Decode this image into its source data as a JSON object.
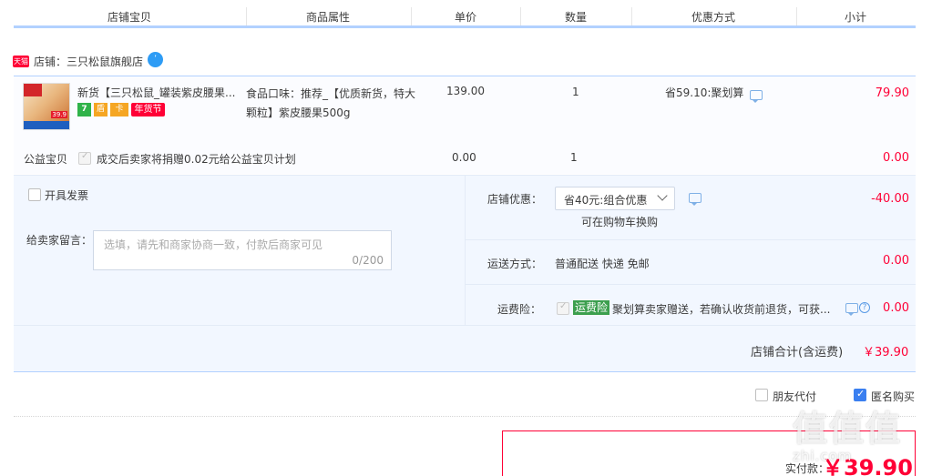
{
  "header": {
    "columns": [
      "店铺宝贝",
      "商品属性",
      "单价",
      "数量",
      "优惠方式",
      "小计"
    ]
  },
  "store": {
    "badge": "天猫",
    "name": "店铺：三只松鼠旗舰店",
    "chat_icon_glyph": "ʼ"
  },
  "item": {
    "thumb_tag": "39.9",
    "title": "新货【三只松鼠_罐装紫皮腰果...",
    "services": [
      "7",
      "盾",
      "卡",
      "年货节"
    ],
    "attr": "食品口味：推荐_【优质新货，特大颗粒】紫皮腰果500g",
    "price": "139.00",
    "qty": "1",
    "promo": "省59.10:聚划算",
    "subtotal": "79.90"
  },
  "charity": {
    "label": "公益宝贝",
    "text": "成交后卖家将捐赠0.02元给公益宝贝计划",
    "price": "0.00",
    "qty": "1",
    "subtotal": "0.00"
  },
  "options": {
    "invoice_label": "开具发票",
    "message_label": "给卖家留言：",
    "message_placeholder": "选填，请先和商家协商一致，付款后商家可见",
    "message_counter": "0/200",
    "store_discount_label": "店铺优惠：",
    "store_discount_value": "省40元:组合优惠",
    "store_discount_note": "可在购物车换购",
    "store_discount_amount": "-40.00",
    "shipping_label": "运送方式：",
    "shipping_value": "普通配送 快递 免邮",
    "shipping_amount": "0.00",
    "insurance_label": "运费险：",
    "insurance_tag": "运费险",
    "insurance_text": "聚划算卖家赠送，若确认收货前退货，可获...",
    "insurance_amount": "0.00",
    "store_total_label": "店铺合计(含运费)",
    "store_total_value": "￥39.90"
  },
  "footer": {
    "friend_pay": "朋友代付",
    "anonymous": "匿名购买",
    "pay_label": "实付款：",
    "pay_value": "￥39.90",
    "watermark": "值值值",
    "watermark_sub": "zhi.com"
  },
  "colors": {
    "accent_red": "#ff0036",
    "header_line": "#b2d1ff",
    "panel_bg": "#f2f7ff",
    "checkbox_blue": "#3a7ff0"
  }
}
